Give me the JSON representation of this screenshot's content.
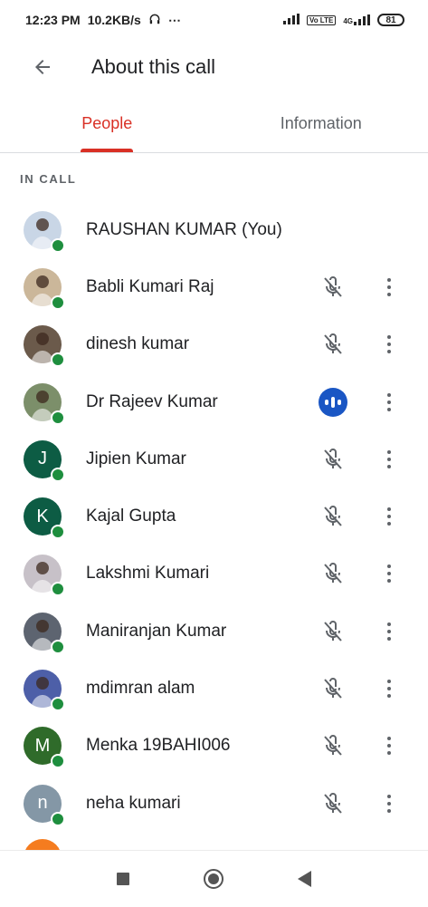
{
  "status_bar": {
    "time": "12:23 PM",
    "speed": "10.2KB/s",
    "extra": "⋯",
    "network": "4G",
    "volte": "Vo LTE",
    "battery": "81"
  },
  "app_bar": {
    "title": "About this call",
    "back_icon": "arrow-left-icon"
  },
  "tabs": [
    {
      "label": "People",
      "active": true
    },
    {
      "label": "Information",
      "active": false
    }
  ],
  "section_label": "IN CALL",
  "participants": [
    {
      "name": "RAUSHAN KUMAR (You)",
      "avatar": "photo",
      "initial": "",
      "avatar_color": "#c9d6e6",
      "status": "none"
    },
    {
      "name": "Babli Kumari Raj",
      "avatar": "photo",
      "initial": "",
      "avatar_color": "#cbb79a",
      "status": "muted"
    },
    {
      "name": "dinesh kumar",
      "avatar": "photo",
      "initial": "",
      "avatar_color": "#6b5a4b",
      "status": "muted"
    },
    {
      "name": "Dr Rajeev Kumar",
      "avatar": "photo",
      "initial": "",
      "avatar_color": "#7c8f6a",
      "status": "speaking"
    },
    {
      "name": "Jipien Kumar",
      "avatar": "initial",
      "initial": "J",
      "avatar_color": "#0d5c44",
      "status": "muted"
    },
    {
      "name": "Kajal Gupta",
      "avatar": "initial",
      "initial": "K",
      "avatar_color": "#0d5c44",
      "status": "muted"
    },
    {
      "name": "Lakshmi Kumari",
      "avatar": "photo",
      "initial": "",
      "avatar_color": "#c7c1c8",
      "status": "muted"
    },
    {
      "name": "Maniranjan Kumar",
      "avatar": "photo",
      "initial": "",
      "avatar_color": "#5d6470",
      "status": "muted"
    },
    {
      "name": "mdimran alam",
      "avatar": "photo",
      "initial": "",
      "avatar_color": "#4d5fa8",
      "status": "muted"
    },
    {
      "name": "Menka 19BAHI006",
      "avatar": "initial",
      "initial": "M",
      "avatar_color": "#2f6b2a",
      "status": "muted"
    },
    {
      "name": "neha kumari",
      "avatar": "initial",
      "initial": "n",
      "avatar_color": "#8497a6",
      "status": "muted"
    }
  ],
  "colors": {
    "accent": "#d93025",
    "online": "#1e8e3e",
    "speaking": "#1a56c4"
  }
}
